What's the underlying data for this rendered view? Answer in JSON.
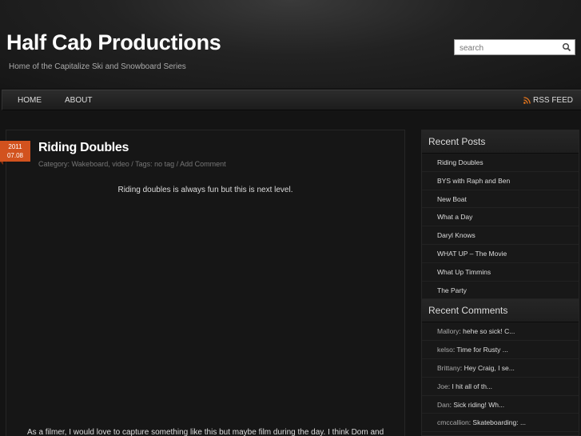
{
  "header": {
    "title": "Half Cab Productions",
    "description": "Home of the Capitalize Ski and Snowboard Series",
    "search_placeholder": "search"
  },
  "nav": {
    "items": [
      {
        "label": "HOME"
      },
      {
        "label": "ABOUT"
      }
    ],
    "rss_label": "RSS FEED"
  },
  "post": {
    "date_year": "2011",
    "date_day": "07.08",
    "title": "Riding Doubles",
    "meta": "Category: Wakeboard, video / Tags: no tag / Add Comment",
    "lead": "Riding doubles is always fun but this is next level.",
    "body": "As a filmer, I would love to capture something like this but maybe film during the day. I think Dom and"
  },
  "sidebar": {
    "recent_posts_title": "Recent Posts",
    "recent_posts": [
      "Riding Doubles",
      "BYS with Raph and Ben",
      "New Boat",
      "What a Day",
      "Daryl Knows",
      "WHAT UP – The Movie",
      "What Up Timmins",
      "The Party"
    ],
    "recent_comments_title": "Recent Comments",
    "recent_comments": [
      {
        "author": "Mallory",
        "text": "hehe so sick! C..."
      },
      {
        "author": "kelso",
        "text": "Time for Rusty ..."
      },
      {
        "author": "Brittany",
        "text": "Hey Craig, I se..."
      },
      {
        "author": "Joe",
        "text": "I hit all of th..."
      },
      {
        "author": "Dan",
        "text": "Sick riding! Wh..."
      },
      {
        "author": "cmccallion",
        "text": "Skateboarding: ..."
      }
    ]
  },
  "colors": {
    "accent": "#d2521e",
    "rss": "#e8771e"
  }
}
